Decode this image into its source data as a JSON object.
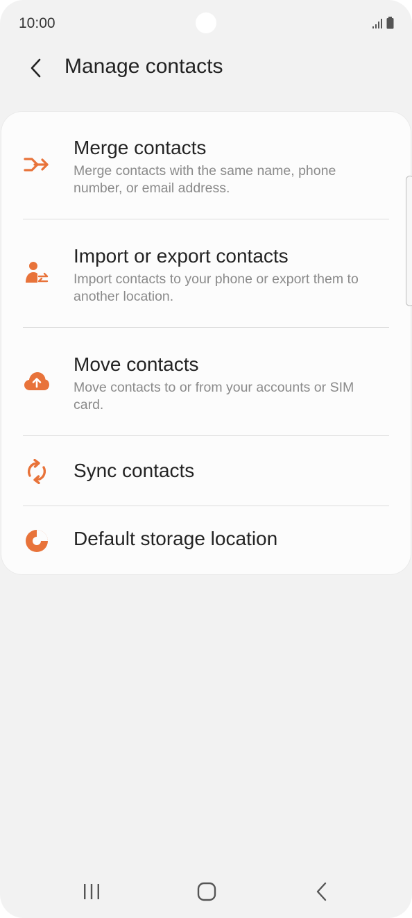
{
  "status_bar": {
    "time": "10:00",
    "icons": [
      "signal-icon",
      "battery-icon"
    ]
  },
  "header": {
    "title": "Manage contacts",
    "back_icon": "chevron-left-icon"
  },
  "accent_color": "#e8733a",
  "menu": {
    "items": [
      {
        "title": "Merge contacts",
        "description": "Merge contacts with the same name, phone number, or email address.",
        "icon": "merge-arrow-icon"
      },
      {
        "title": "Import or export contacts",
        "description": "Import contacts to your phone or export them to another location.",
        "icon": "person-transfer-icon"
      },
      {
        "title": "Move contacts",
        "description": "Move contacts to or from your accounts or SIM card.",
        "icon": "cloud-upload-icon"
      },
      {
        "title": "Sync contacts",
        "description": "",
        "icon": "sync-icon"
      },
      {
        "title": "Default storage location",
        "description": "",
        "icon": "pie-chart-icon"
      }
    ]
  },
  "nav_bar": {
    "buttons": [
      "recent-apps-icon",
      "home-icon",
      "back-icon"
    ]
  }
}
